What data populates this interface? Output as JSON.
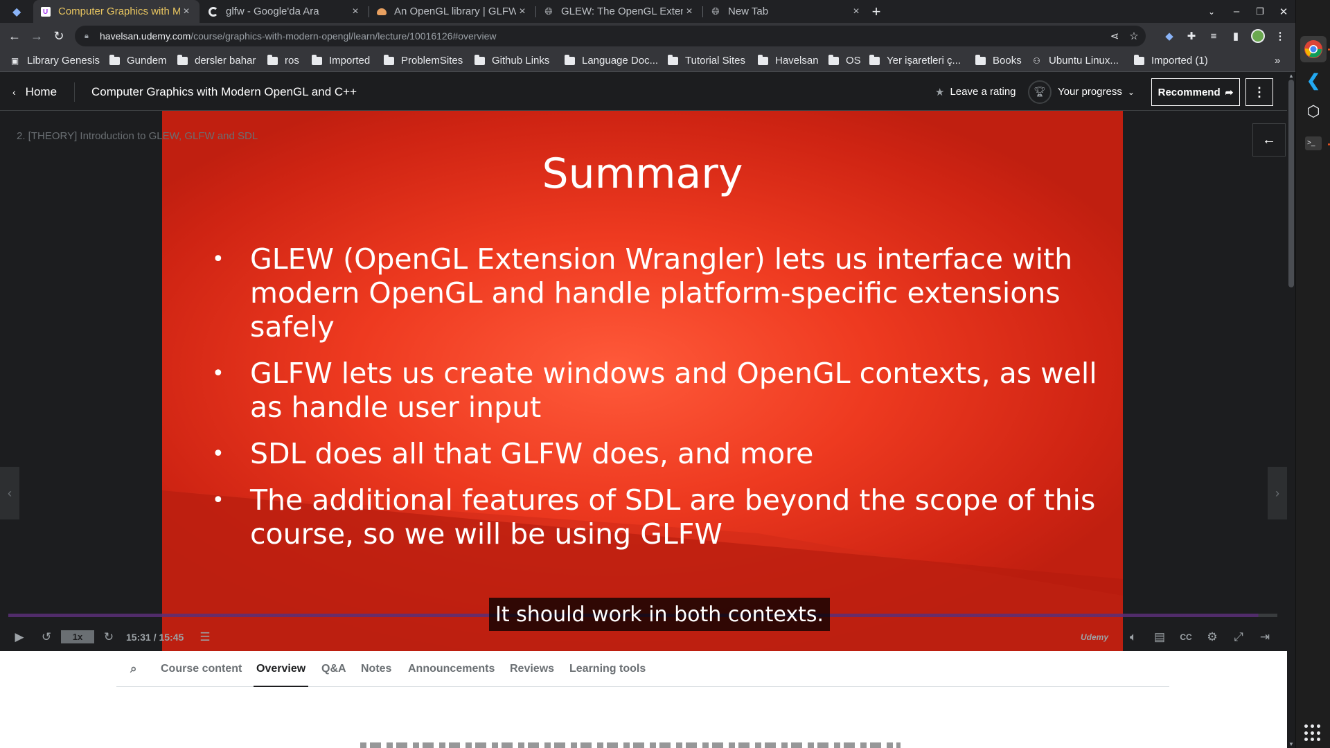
{
  "browser": {
    "tabs": [
      {
        "title": "Computer Graphics with M",
        "favicon": "udemy-icon",
        "active": true
      },
      {
        "title": "glfw - Google'da Ara",
        "favicon": "google-icon",
        "active": false
      },
      {
        "title": "An OpenGL library | GLFW",
        "favicon": "glfw-icon",
        "active": false
      },
      {
        "title": "GLEW: The OpenGL Extensi",
        "favicon": "globe-icon",
        "active": false
      },
      {
        "title": "New Tab",
        "favicon": "globe-icon",
        "active": false
      }
    ],
    "new_tab_label": "+",
    "url_host": "havelsan.udemy.com",
    "url_path": "/course/graphics-with-modern-opengl/learn/lecture/10016126#overview",
    "bookmarks": [
      {
        "label": "Library Genesis",
        "icon": "library-icon"
      },
      {
        "label": "Gundem",
        "icon": "folder-icon"
      },
      {
        "label": "dersler bahar",
        "icon": "folder-icon"
      },
      {
        "label": "ros",
        "icon": "folder-icon"
      },
      {
        "label": "Imported",
        "icon": "folder-icon"
      },
      {
        "label": "ProblemSites",
        "icon": "folder-icon"
      },
      {
        "label": "Github Links",
        "icon": "folder-icon"
      },
      {
        "label": "Language Doc...",
        "icon": "folder-icon"
      },
      {
        "label": "Tutorial Sites",
        "icon": "folder-icon"
      },
      {
        "label": "Havelsan",
        "icon": "folder-icon"
      },
      {
        "label": "OS",
        "icon": "folder-icon"
      },
      {
        "label": "Yer işaretleri ç...",
        "icon": "folder-icon"
      },
      {
        "label": "Books",
        "icon": "folder-icon"
      },
      {
        "label": "Ubuntu Linux...",
        "icon": "ubuntu-icon"
      },
      {
        "label": "Imported (1)",
        "icon": "folder-icon"
      }
    ],
    "bookmarks_overflow": "»"
  },
  "header": {
    "home_label": "Home",
    "course_title": "Computer Graphics with Modern OpenGL and C++",
    "rating_label": "Leave a rating",
    "progress_label": "Your progress",
    "recommend_label": "Recommend"
  },
  "video": {
    "lecture_label": "2. [THEORY] Introduction to GLEW, GLFW and SDL",
    "slide_title": "Summary",
    "bullets": [
      "GLEW (OpenGL Extension Wrangler) lets us interface with modern OpenGL and handle platform-specific extensions safely",
      "GLFW lets us create windows and OpenGL contexts, as well as handle user input",
      "SDL does all that GLFW does, and more",
      "The additional features of SDL are beyond the scope of this course, so we will be using GLFW"
    ],
    "caption": "It should work in both contexts.",
    "speed": "1x",
    "time": "15:31 / 15:45",
    "brand": "Udemy",
    "progress_fraction": 0.985
  },
  "content_tabs": [
    "Course content",
    "Overview",
    "Q&A",
    "Notes",
    "Announcements",
    "Reviews",
    "Learning tools"
  ],
  "active_content_tab": "Overview",
  "colors": {
    "slide_red": "#e8341c",
    "udemy_dark": "#1c1d1f",
    "scrub_purple": "#5a2f77",
    "chrome_dark": "#202124",
    "chrome_toolbar": "#35363a"
  }
}
